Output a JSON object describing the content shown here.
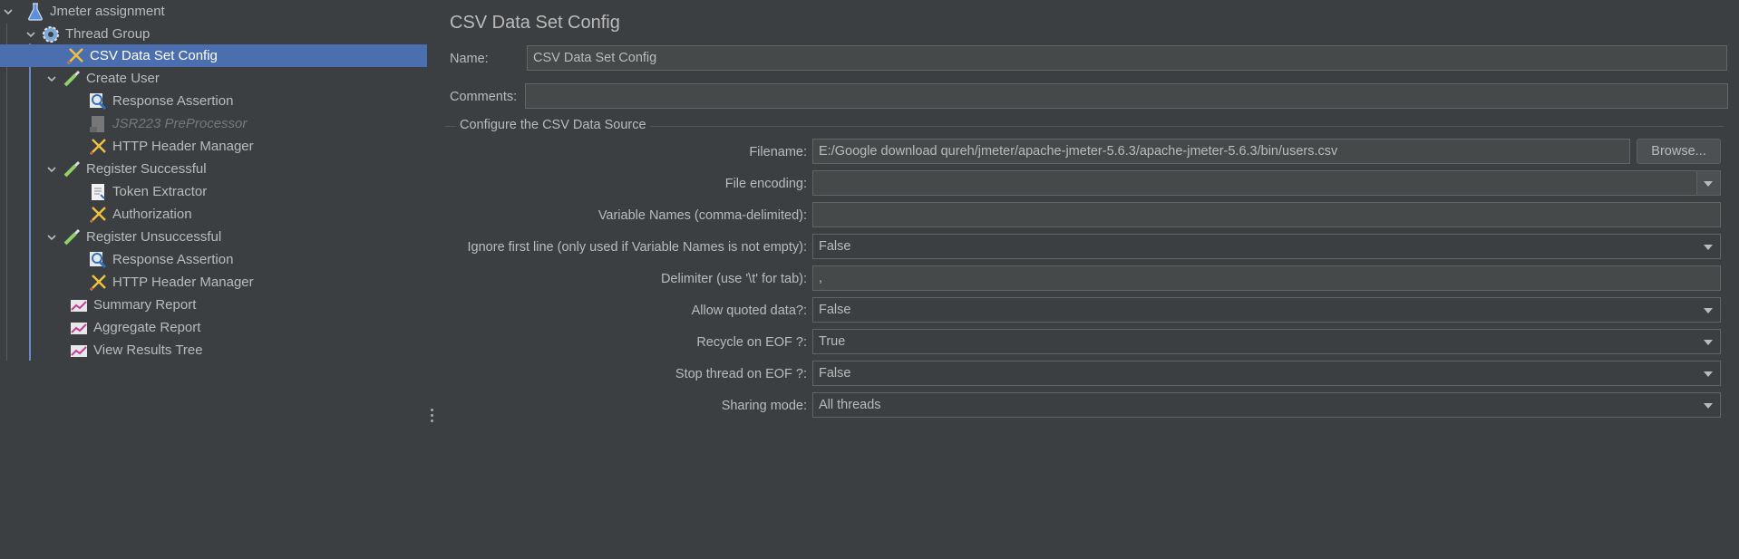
{
  "tree": {
    "items": [
      {
        "label": "Jmeter assignment",
        "icon": "flask-icon"
      },
      {
        "label": "Thread Group",
        "icon": "gear-icon"
      },
      {
        "label": "CSV Data Set Config",
        "icon": "wrench-screwdriver-icon"
      },
      {
        "label": "Create User",
        "icon": "pipette-icon"
      },
      {
        "label": "Response Assertion",
        "icon": "magnifier-icon"
      },
      {
        "label": "JSR223 PreProcessor",
        "icon": "script-icon"
      },
      {
        "label": "HTTP Header Manager",
        "icon": "wrench-screwdriver-icon"
      },
      {
        "label": "Register Successful",
        "icon": "pipette-icon"
      },
      {
        "label": "Token Extractor",
        "icon": "document-icon"
      },
      {
        "label": "Authorization",
        "icon": "wrench-screwdriver-icon"
      },
      {
        "label": "Register Unsuccessful",
        "icon": "pipette-icon"
      },
      {
        "label": "Response Assertion",
        "icon": "magnifier-icon"
      },
      {
        "label": "HTTP Header Manager",
        "icon": "wrench-screwdriver-icon"
      },
      {
        "label": "Summary Report",
        "icon": "chart-icon"
      },
      {
        "label": "Aggregate Report",
        "icon": "chart-icon"
      },
      {
        "label": "View Results Tree",
        "icon": "chart-icon"
      }
    ]
  },
  "panel": {
    "title": "CSV Data Set Config",
    "name_label": "Name:",
    "name_value": "CSV Data Set Config",
    "comments_label": "Comments:",
    "comments_value": "",
    "group_title": "Configure the CSV Data Source",
    "filename_label": "Filename:",
    "filename_value": "E:/Google download qureh/jmeter/apache-jmeter-5.6.3/apache-jmeter-5.6.3/bin/users.csv",
    "browse_label": "Browse...",
    "encoding_label": "File encoding:",
    "encoding_value": "",
    "varnames_label": "Variable Names (comma-delimited):",
    "varnames_value": "",
    "ignore_label": "Ignore first line (only used if Variable Names is not empty):",
    "ignore_value": "False",
    "delimiter_label": "Delimiter (use '\\t' for tab):",
    "delimiter_value": ",",
    "quoted_label": "Allow quoted data?:",
    "quoted_value": "False",
    "recycle_label": "Recycle on EOF ?:",
    "recycle_value": "True",
    "stop_label": "Stop thread on EOF ?:",
    "stop_value": "False",
    "sharing_label": "Sharing mode:",
    "sharing_value": "All threads"
  },
  "colors": {
    "background": "#3c3f41",
    "selection": "#4b6eaf",
    "field_bg": "#45494a",
    "text": "#bbbbbb"
  }
}
